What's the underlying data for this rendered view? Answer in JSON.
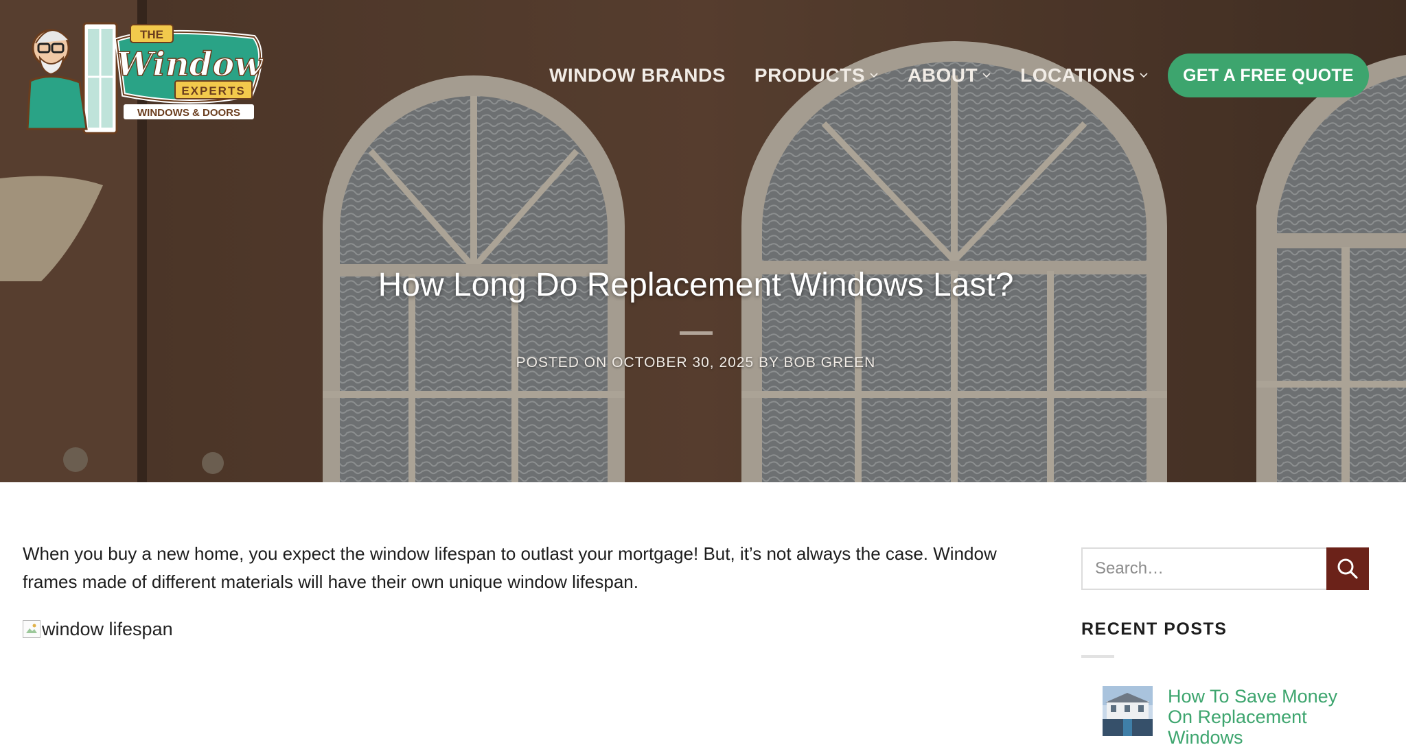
{
  "brand": {
    "logo_top": "THE",
    "logo_main": "Window",
    "logo_sub": "EXPERTS",
    "logo_tagline": "WINDOWS & DOORS"
  },
  "nav": {
    "items": [
      {
        "label": "WINDOW BRANDS",
        "has_dropdown": false
      },
      {
        "label": "PRODUCTS",
        "has_dropdown": true
      },
      {
        "label": "ABOUT",
        "has_dropdown": true
      },
      {
        "label": "LOCATIONS",
        "has_dropdown": true
      }
    ],
    "cta_label": "GET A FREE QUOTE"
  },
  "post": {
    "title": "How Long Do Replacement Windows Last?",
    "meta": "POSTED ON OCTOBER 30, 2025 BY BOB GREEN",
    "intro": "When you buy a new home, you expect the window lifespan to outlast your mortgage! But, it’s not always the case. Window frames made of different materials will have their own unique window lifespan.",
    "image_alt": "window lifespan"
  },
  "sidebar": {
    "search_placeholder": "Search…",
    "recent_heading": "RECENT POSTS",
    "recent_posts": [
      {
        "title": "How To Save Money On Replacement Windows"
      }
    ]
  },
  "colors": {
    "accent_green": "#3da56e",
    "search_button": "#6b2219",
    "logo_teal": "#2aa386",
    "logo_yellow": "#f2c94c"
  }
}
